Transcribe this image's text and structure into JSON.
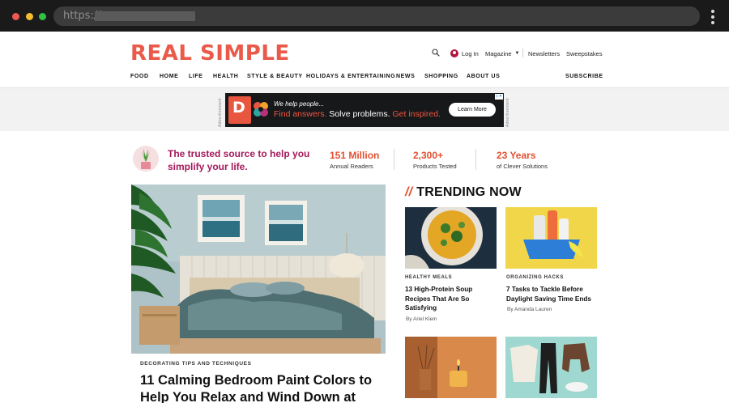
{
  "browser": {
    "url_prefix": "https://"
  },
  "header": {
    "logo": "REAL SIMPLE",
    "login_label": "Log In",
    "magazine_label": "Magazine",
    "newsletters_label": "Newsletters",
    "sweepstakes_label": "Sweepstakes",
    "nav": [
      "FOOD",
      "HOME",
      "LIFE",
      "HEALTH",
      "STYLE & BEAUTY",
      "HOLIDAYS & ENTERTAINING",
      "NEWS",
      "SHOPPING",
      "ABOUT US"
    ],
    "subscribe_label": "SUBSCRIBE"
  },
  "ad": {
    "label": "Advertisement",
    "badge": "D",
    "tagline": "We help people...",
    "segments": [
      "Find answers.",
      "Solve problems.",
      "Get inspired."
    ],
    "button_label": "Learn More"
  },
  "trust": {
    "text": "The trusted source to help you simplify your life.",
    "stats": [
      {
        "value": "151 Million",
        "label": "Annual Readers"
      },
      {
        "value": "2,300+",
        "label": "Products Tested"
      },
      {
        "value": "23 Years",
        "label": "of Clever Solutions"
      }
    ]
  },
  "hero": {
    "kicker": "DECORATING TIPS AND TECHNIQUES",
    "title": "11 Calming Bedroom Paint Colors to Help You Relax and Wind Down at"
  },
  "trending": {
    "slashes": "//",
    "heading": "TRENDING NOW",
    "cards": [
      {
        "kicker": "HEALTHY MEALS",
        "title": "13 High-Protein Soup Recipes That Are So Satisfying",
        "byline": "By Ariel Klein"
      },
      {
        "kicker": "ORGANIZING HACKS",
        "title": "7 Tasks to Tackle Before Daylight Saving Time Ends",
        "byline": "By Amanda Lauren"
      }
    ]
  },
  "colors": {
    "brand": "#ea5a4a",
    "trust_text": "#a4195b",
    "stat": "#e2502f"
  }
}
